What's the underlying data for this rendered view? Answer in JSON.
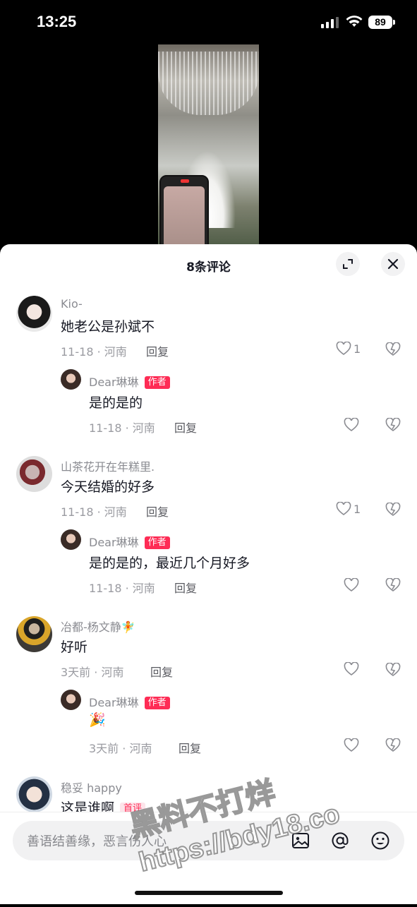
{
  "status_bar": {
    "time": "13:25",
    "battery": "89"
  },
  "sheet": {
    "title": "8条评论"
  },
  "comments": [
    {
      "user": "Kio-",
      "text": "她老公是孙斌不",
      "date": "11-18",
      "location": "河南",
      "reply": "回复",
      "likes": "1",
      "replies": [
        {
          "user": "Dear琳琳",
          "tag": "作者",
          "text": "是的是的",
          "date": "11-18",
          "location": "河南",
          "reply": "回复"
        }
      ]
    },
    {
      "user": "山茶花开在年糕里.",
      "text": "今天结婚的好多",
      "date": "11-18",
      "location": "河南",
      "reply": "回复",
      "likes": "1",
      "replies": [
        {
          "user": "Dear琳琳",
          "tag": "作者",
          "text": "是的是的，最近几个月好多",
          "date": "11-18",
          "location": "河南",
          "reply": "回复"
        }
      ]
    },
    {
      "user": "冶都-杨文静🧚",
      "text": "好听",
      "date": "3天前",
      "location": "河南",
      "reply": "回复",
      "replies": [
        {
          "user": "Dear琳琳",
          "tag": "作者",
          "text": "🎉",
          "date": "3天前",
          "location": "河南",
          "reply": "回复"
        }
      ]
    },
    {
      "user": "稳妥 happy",
      "text": "这是谁啊",
      "badge": "首评"
    }
  ],
  "input": {
    "placeholder": "善语结善缘，恶言伤人心"
  },
  "watermark": {
    "line1": "黑料不打烊",
    "line2": "https://bdy18.co"
  },
  "icons": [
    "expand-icon",
    "close-icon",
    "heart-icon",
    "dislike-icon",
    "image-icon",
    "at-icon",
    "emoji-icon"
  ]
}
